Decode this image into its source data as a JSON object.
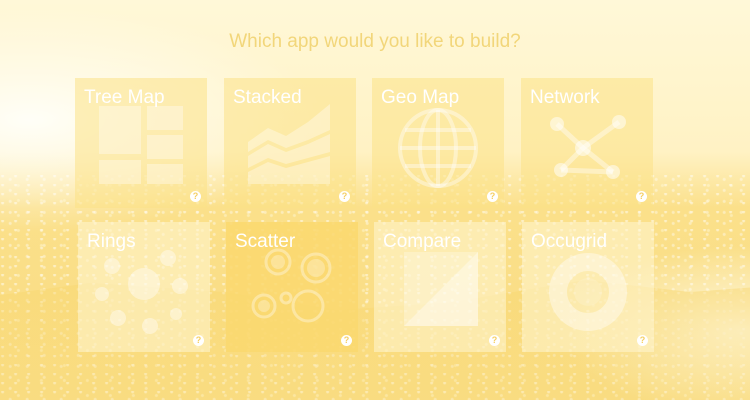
{
  "page": {
    "title": "Which app would you like to build?"
  },
  "apps": [
    {
      "label": "Tree Map",
      "icon": "tree-map-icon",
      "help": "?"
    },
    {
      "label": "Stacked",
      "icon": "stacked-area-icon",
      "help": "?"
    },
    {
      "label": "Geo Map",
      "icon": "globe-icon",
      "help": "?"
    },
    {
      "label": "Network",
      "icon": "network-icon",
      "help": "?"
    },
    {
      "label": "Rings",
      "icon": "rings-icon",
      "help": "?"
    },
    {
      "label": "Scatter",
      "icon": "scatter-icon",
      "help": "?"
    },
    {
      "label": "Compare",
      "icon": "compare-icon",
      "help": "?"
    },
    {
      "label": "Occugrid",
      "icon": "occugrid-icon",
      "help": "?"
    }
  ],
  "colors": {
    "accent": "#f2d67a",
    "tile": "#fce287",
    "active_tile": "#fad86e",
    "text": "#ffffff"
  }
}
